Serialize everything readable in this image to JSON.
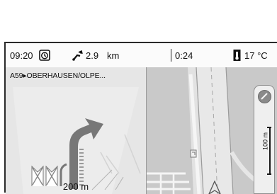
{
  "status": {
    "time": "09:20",
    "distance_value": "2.9",
    "distance_unit": "km",
    "remaining_time": "0:24",
    "temperature": "17 °C"
  },
  "guidance": {
    "road_label": "A59▸OBERHAUSEN/OLPE...",
    "distance_to_turn": "200 m"
  },
  "map": {
    "scale_label": "100 m"
  },
  "icons": {
    "clock": "clock-icon",
    "distance": "route-distance-icon",
    "thermometer": "thermometer-icon",
    "compass": "compass-icon",
    "turn": "turn-right-arrow-icon",
    "vehicle": "vehicle-position-icon"
  }
}
